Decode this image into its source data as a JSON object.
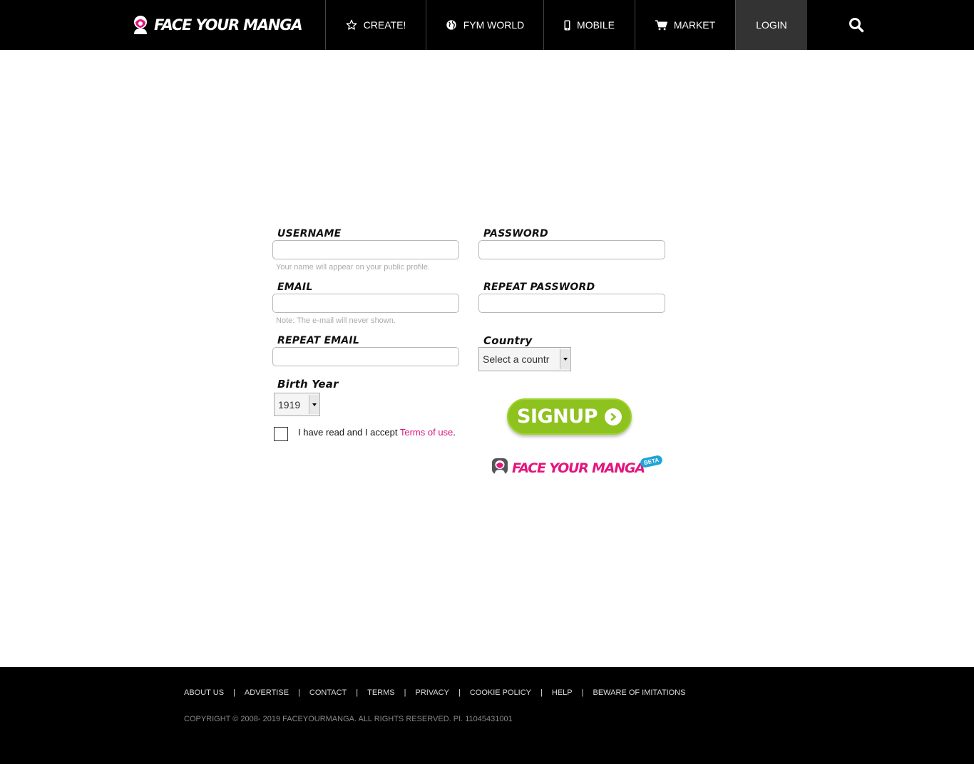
{
  "brand": {
    "name": "FACE YOUR MANGA",
    "beta": "BETA"
  },
  "nav": {
    "create": "CREATE!",
    "world": "FYM WORLD",
    "mobile": "MOBILE",
    "market": "MARKET",
    "login": "LOGIN"
  },
  "form": {
    "username_label": "USERNAME",
    "username_hint": "Your name will appear on your public profile.",
    "password_label": "PASSWORD",
    "email_label": "EMAIL",
    "email_hint": "Note: The e-mail will never shown.",
    "repeat_password_label": "REPEAT PASSWORD",
    "repeat_email_label": "REPEAT EMAIL",
    "country_label": "Country",
    "country_value": "Select a countr",
    "birth_year_label": "Birth Year",
    "birth_year_value": "1919",
    "terms_prefix": "I have read and I accept ",
    "terms_link": "Terms of use",
    "terms_suffix": ".",
    "signup": "SIGNUP"
  },
  "footer": {
    "links": [
      "ABOUT US",
      "ADVERTISE",
      "CONTACT",
      "TERMS",
      "PRIVACY",
      "COOKIE POLICY",
      "HELP",
      "BEWARE OF IMITATIONS"
    ],
    "separator": "|",
    "copyright": "COPYRIGHT © 2008- 2019 FACEYOURMANGA. ALL RIGHTS RESERVED. PI. 11045431001"
  },
  "colors": {
    "accent_pink": "#e4157f",
    "signup_green": "#8ec21e",
    "header_bg": "#000000",
    "active_tab": "#333333"
  },
  "icons": [
    "star-icon",
    "globe-icon",
    "mobile-icon",
    "cart-icon",
    "search-icon",
    "chevron-right-icon"
  ]
}
